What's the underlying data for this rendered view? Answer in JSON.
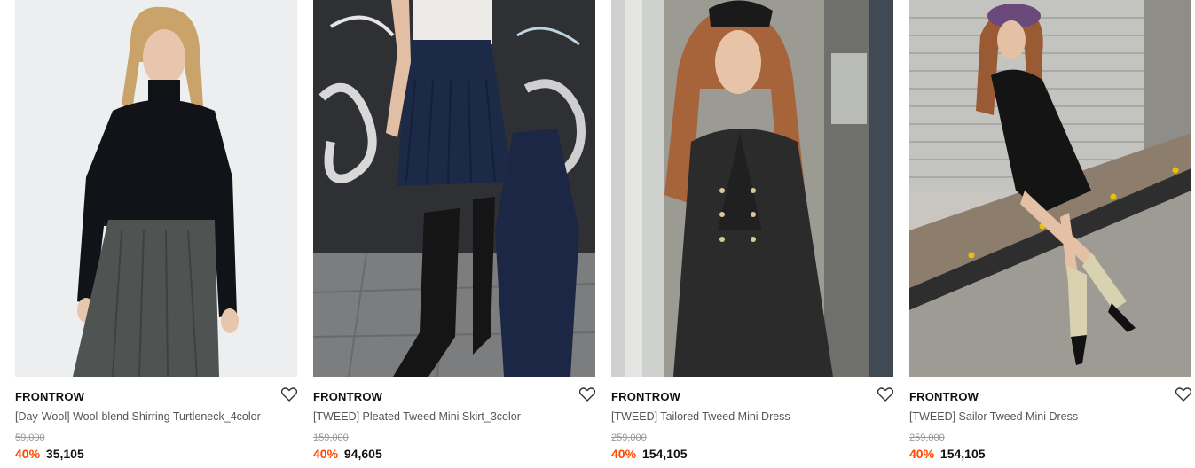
{
  "products": [
    {
      "brand": "FRONTROW",
      "name": "[Day-Wool] Wool-blend Shirring Turtleneck_4color",
      "original_price": "59,000",
      "discount": "40%",
      "sale_price": "35,105",
      "wishlist_icon": "heart-outline-icon"
    },
    {
      "brand": "FRONTROW",
      "name": "[TWEED] Pleated Tweed Mini Skirt_3color",
      "original_price": "159,000",
      "discount": "40%",
      "sale_price": "94,605",
      "wishlist_icon": "heart-outline-icon"
    },
    {
      "brand": "FRONTROW",
      "name": "[TWEED] Tailored Tweed Mini Dress",
      "original_price": "259,000",
      "discount": "40%",
      "sale_price": "154,105",
      "wishlist_icon": "heart-outline-icon"
    },
    {
      "brand": "FRONTROW",
      "name": "[TWEED] Sailor Tweed Mini Dress",
      "original_price": "259,000",
      "discount": "40%",
      "sale_price": "154,105",
      "wishlist_icon": "heart-outline-icon"
    }
  ],
  "colors": {
    "discount": "#ff4800",
    "brand_text": "#111111",
    "name_text": "#555555",
    "original_price_text": "#999999"
  }
}
